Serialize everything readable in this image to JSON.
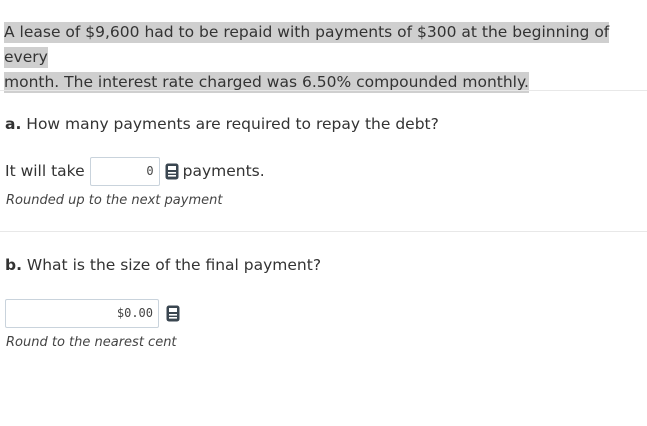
{
  "problem": {
    "line1": "A lease of $9,600 had to be repaid with payments of $300 at the beginning of every",
    "line2": "month. The interest rate charged was 6.50% compounded monthly."
  },
  "part_a": {
    "label": "a.",
    "question": " How many payments are required to repay the debt?",
    "prefix": "It will take",
    "input_value": "0",
    "suffix": "payments.",
    "hint": "Rounded up to the next payment",
    "calculator_icon": "calculator-icon"
  },
  "part_b": {
    "label": "b.",
    "question": " What is the size of the final payment?",
    "input_value": "$0.00",
    "hint": "Round to the nearest cent",
    "calculator_icon": "calculator-icon"
  },
  "colors": {
    "highlight": "#cfcfcf",
    "icon": "#3a4650",
    "input_border": "#c9d3dc"
  }
}
